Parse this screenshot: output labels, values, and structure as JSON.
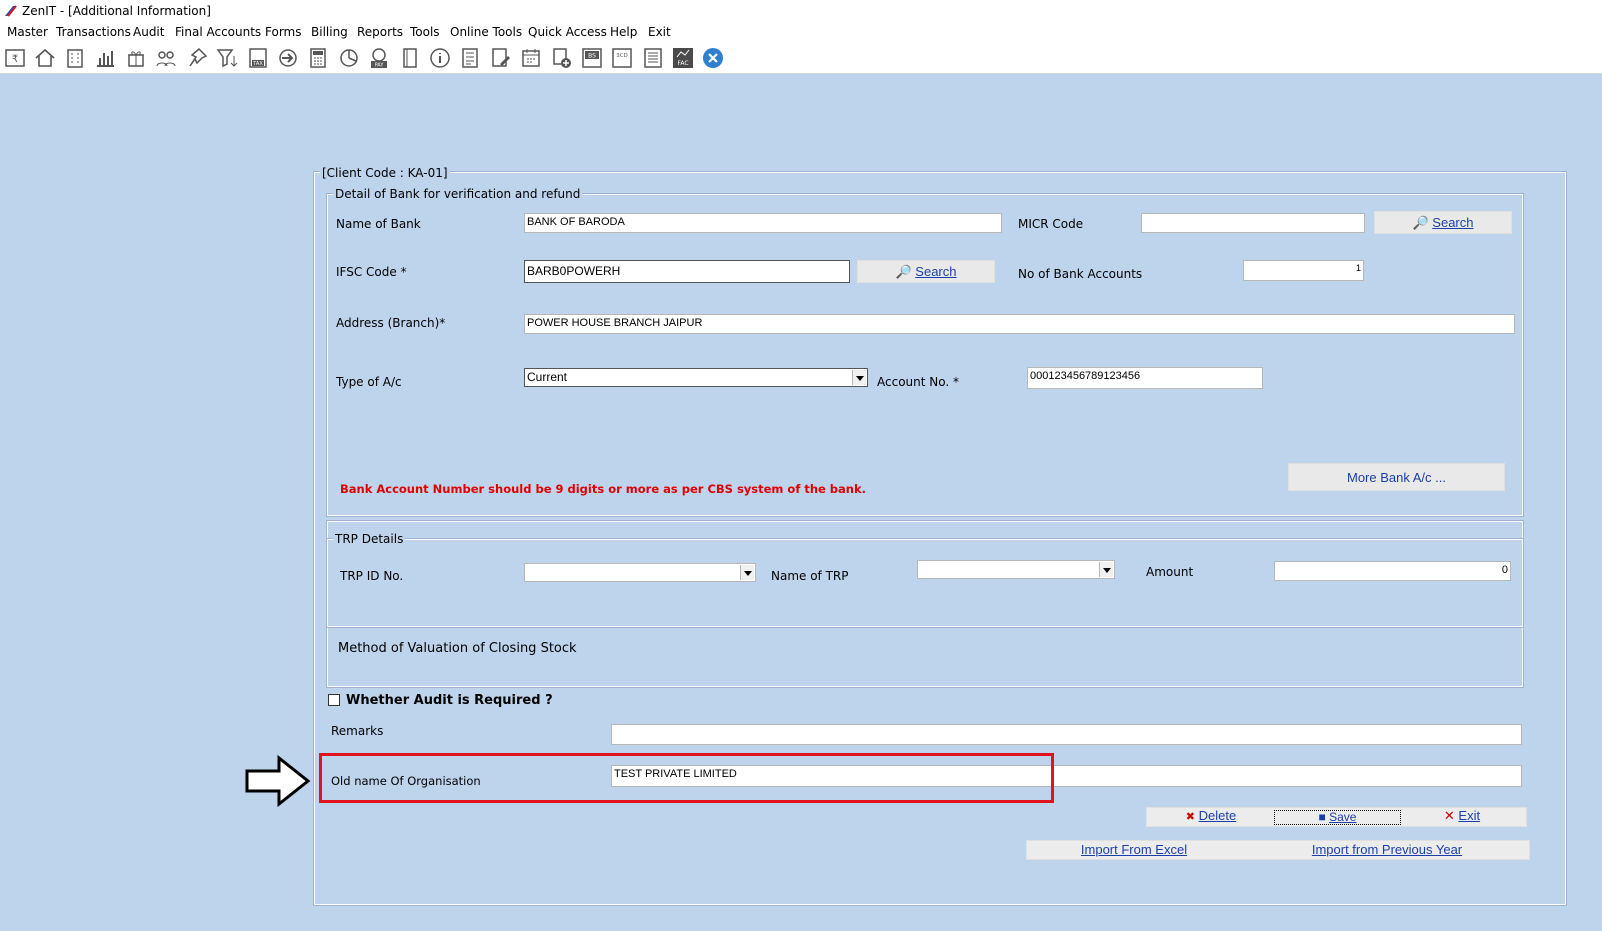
{
  "window": {
    "title": "ZenIT - [Additional Information]"
  },
  "menu": [
    "Master",
    "Transactions",
    "Audit",
    "Final Accounts",
    "Forms",
    "Billing",
    "Reports",
    "Tools",
    "Online Tools",
    "Quick Access",
    "Help",
    "Exit"
  ],
  "toolbar_icons": [
    "rupee-register-icon",
    "home-icon",
    "building-icon",
    "bar-chart-icon",
    "gift-icon",
    "users-icon",
    "pin-icon",
    "filter-icon",
    "tax-icon",
    "arrow-circle-icon",
    "calculator-icon",
    "pie-chart-icon",
    "pay-icon",
    "book-icon",
    "info-icon",
    "report-icon",
    "edit-doc-icon",
    "calendar-icon",
    "add-doc-icon",
    "bs-icon",
    "3cd-icon",
    "list-icon",
    "fac-icon",
    "close-icon"
  ],
  "toolbar_text": {
    "tax": "TAX",
    "pay": "PAY",
    "bs": "BS",
    "cd": "3CD",
    "fac": "FAC"
  },
  "form": {
    "client_code": "[Client Code : KA-01]",
    "bank_section": {
      "legend": "Detail of Bank for verification and refund",
      "name_of_bank_label": "Name of Bank",
      "name_of_bank_value": "BANK OF BARODA",
      "micr_label": "MICR Code",
      "micr_value": "",
      "search_label": "Search",
      "ifsc_label": "IFSC Code *",
      "ifsc_value": "BARB0POWERH",
      "no_accounts_label": "No of Bank Accounts",
      "no_accounts_value": "1",
      "address_label": "Address (Branch)*",
      "address_value": "POWER HOUSE BRANCH JAIPUR",
      "type_label": "Type of A/c",
      "type_value": "Current",
      "account_label": "Account No. *",
      "account_value": "000123456789123456",
      "warning": "Bank Account Number should be 9 digits or more as per CBS system of the bank.",
      "more_bank_label": "More Bank A/c ...",
      "warning_color": "#e00000"
    },
    "trp_section": {
      "legend": "TRP Details",
      "trp_id_label": "TRP ID No.",
      "trp_id_value": "",
      "name_trp_label": "Name of TRP",
      "name_trp_value": "",
      "amount_label": "Amount",
      "amount_value": "0"
    },
    "valuation_label": "Method of Valuation of Closing Stock",
    "audit_label": "Whether Audit is Required ?",
    "audit_checked": false,
    "remarks_label": "Remarks",
    "remarks_value": "",
    "old_name_label": "Old name Of Organisation",
    "old_name_value": "TEST PRIVATE LIMITED",
    "highlight_color": "#e0141e",
    "buttons": {
      "delete": "Delete",
      "save": "Save",
      "exit": "Exit",
      "import_excel": "Import From Excel",
      "import_prev": "Import from Previous Year"
    }
  }
}
